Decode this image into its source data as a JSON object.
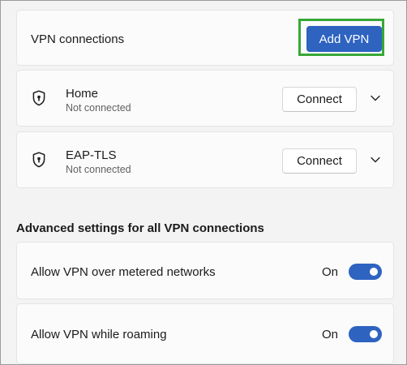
{
  "header": {
    "title": "VPN connections",
    "add_label": "Add VPN"
  },
  "connections": [
    {
      "name": "Home",
      "status": "Not connected",
      "action_label": "Connect"
    },
    {
      "name": "EAP-TLS",
      "status": "Not connected",
      "action_label": "Connect"
    }
  ],
  "advanced": {
    "title": "Advanced settings for all VPN connections",
    "settings": [
      {
        "label": "Allow VPN over metered networks",
        "state": "On"
      },
      {
        "label": "Allow VPN while roaming",
        "state": "On"
      }
    ]
  },
  "colors": {
    "accent": "#2e63c0",
    "highlight": "#36a836",
    "card_bg": "#fbfbfb",
    "page_bg": "#f3f3f3"
  },
  "icons": {
    "connection": "shield-lock-icon",
    "expand": "chevron-down-icon"
  }
}
